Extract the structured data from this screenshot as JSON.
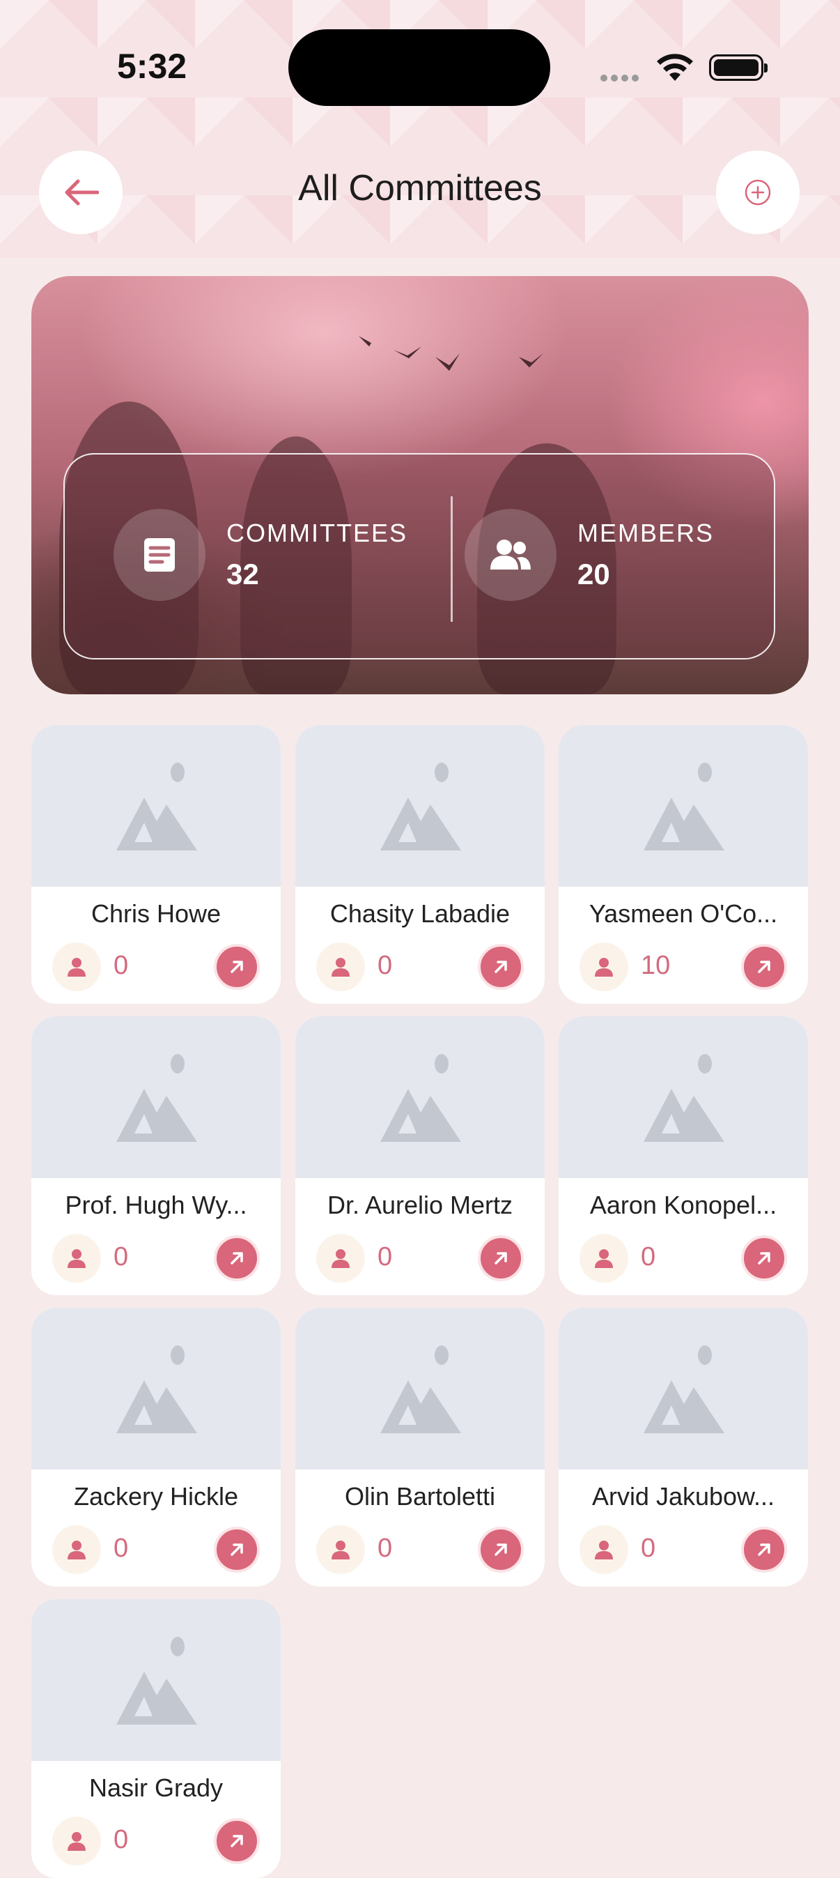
{
  "status_bar": {
    "time": "5:32"
  },
  "header": {
    "title": "All Committees"
  },
  "stats": {
    "committees_label": "COMMITTEES",
    "committees_value": "32",
    "members_label": "MEMBERS",
    "members_value": "20"
  },
  "committees": [
    {
      "name": "Chris Howe",
      "members": "0"
    },
    {
      "name": "Chasity Labadie",
      "members": "0"
    },
    {
      "name": "Yasmeen O'Co...",
      "members": "10"
    },
    {
      "name": "Prof. Hugh Wy...",
      "members": "0"
    },
    {
      "name": "Dr. Aurelio Mertz",
      "members": "0"
    },
    {
      "name": "Aaron Konopel...",
      "members": "0"
    },
    {
      "name": "Zackery Hickle",
      "members": "0"
    },
    {
      "name": "Olin Bartoletti",
      "members": "0"
    },
    {
      "name": "Arvid Jakubow...",
      "members": "0"
    },
    {
      "name": "Nasir Grady",
      "members": "0"
    }
  ],
  "colors": {
    "accent": "#d9667a",
    "background": "#f6ebea",
    "placeholder": "#e5e7ef"
  }
}
